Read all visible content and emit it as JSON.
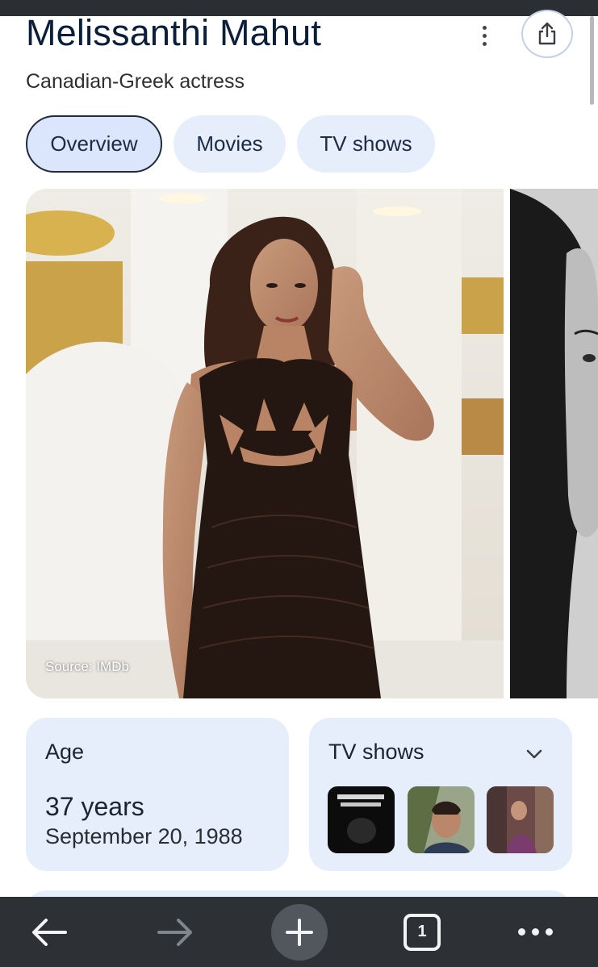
{
  "header": {
    "title": "Melissanthi Mahut",
    "subtitle": "Canadian-Greek actress",
    "more_icon": "more-vert-icon",
    "share_icon": "share-icon"
  },
  "tabs": [
    {
      "label": "Overview",
      "active": true
    },
    {
      "label": "Movies",
      "active": false
    },
    {
      "label": "TV shows",
      "active": false
    }
  ],
  "images": {
    "source_label": "Source: IMDb"
  },
  "age_card": {
    "label": "Age",
    "value": "37 years",
    "birth_date": "September 20, 1988"
  },
  "tv_card": {
    "label": "TV shows",
    "expand_icon": "chevron-down-icon",
    "thumbnails": [
      "tv-show-thumbnail-1",
      "tv-show-thumbnail-2",
      "tv-show-thumbnail-3"
    ]
  },
  "browser_nav": {
    "back_icon": "arrow-left-icon",
    "forward_icon": "arrow-right-icon",
    "new_tab_icon": "plus-icon",
    "tab_count": "1",
    "menu_icon": "more-horiz-icon"
  },
  "colors": {
    "chip_bg": "#e6edfb",
    "chip_active_bg": "#dbe6fd",
    "title_color": "#0b1f3b",
    "nav_bg": "#2d3034"
  }
}
